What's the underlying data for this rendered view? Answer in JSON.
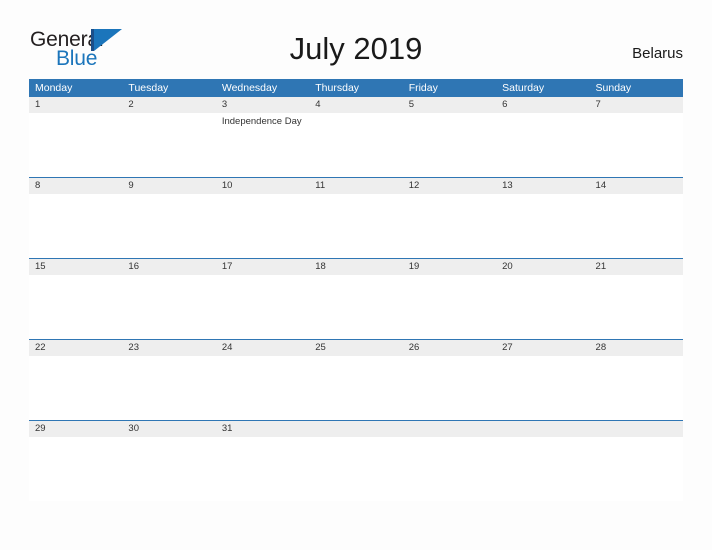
{
  "logo": {
    "word_one": "General",
    "word_two": "Blue",
    "flag_icon": "flag-triangle-icon"
  },
  "header": {
    "title": "July 2019",
    "country": "Belarus"
  },
  "calendar": {
    "weekdays": [
      "Monday",
      "Tuesday",
      "Wednesday",
      "Thursday",
      "Friday",
      "Saturday",
      "Sunday"
    ],
    "accent_color": "#2f76b4",
    "date_band_color": "#eeeeee",
    "weeks": [
      {
        "dates": [
          "1",
          "2",
          "3",
          "4",
          "5",
          "6",
          "7"
        ],
        "events": [
          "",
          "",
          "Independence Day",
          "",
          "",
          "",
          ""
        ]
      },
      {
        "dates": [
          "8",
          "9",
          "10",
          "11",
          "12",
          "13",
          "14"
        ],
        "events": [
          "",
          "",
          "",
          "",
          "",
          "",
          ""
        ]
      },
      {
        "dates": [
          "15",
          "16",
          "17",
          "18",
          "19",
          "20",
          "21"
        ],
        "events": [
          "",
          "",
          "",
          "",
          "",
          "",
          ""
        ]
      },
      {
        "dates": [
          "22",
          "23",
          "24",
          "25",
          "26",
          "27",
          "28"
        ],
        "events": [
          "",
          "",
          "",
          "",
          "",
          "",
          ""
        ]
      },
      {
        "dates": [
          "29",
          "30",
          "31",
          "",
          "",
          "",
          ""
        ],
        "events": [
          "",
          "",
          "",
          "",
          "",
          "",
          ""
        ]
      }
    ]
  }
}
